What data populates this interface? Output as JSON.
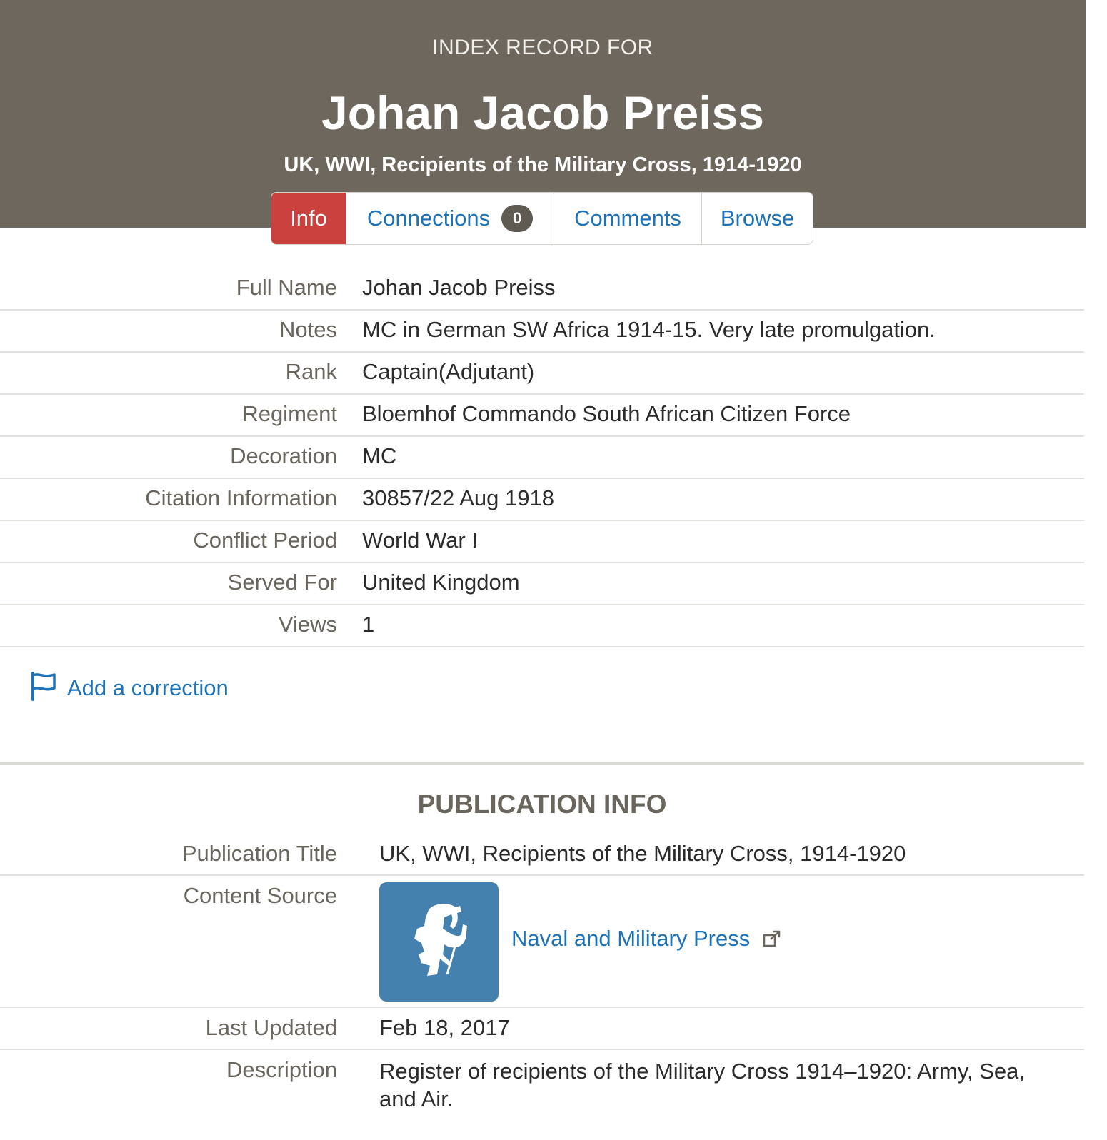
{
  "header": {
    "kicker": "INDEX RECORD FOR",
    "title": "Johan Jacob Preiss",
    "subtitle": "UK, WWI, Recipients of the Military Cross, 1914-1920",
    "background_color": "#6d675d"
  },
  "tabs": [
    {
      "label": "Info",
      "active": true
    },
    {
      "label": "Connections",
      "count": "0",
      "active": false
    },
    {
      "label": "Comments",
      "active": false
    },
    {
      "label": "Browse",
      "active": false
    }
  ],
  "record": {
    "rows": [
      {
        "label": "Full Name",
        "value": "Johan Jacob Preiss"
      },
      {
        "label": "Notes",
        "value": "MC in German SW Africa 1914-15. Very late promulgation."
      },
      {
        "label": "Rank",
        "value": "Captain(Adjutant)"
      },
      {
        "label": "Regiment",
        "value": "Bloemhof Commando South African Citizen Force"
      },
      {
        "label": "Decoration",
        "value": "MC"
      },
      {
        "label": "Citation Information",
        "value": "30857/22 Aug 1918"
      },
      {
        "label": "Conflict Period",
        "value": "World War I"
      },
      {
        "label": "Served For",
        "value": "United Kingdom"
      },
      {
        "label": "Views",
        "value": "1"
      }
    ]
  },
  "correction": {
    "label": "Add a correction",
    "icon": "flag-icon"
  },
  "publication": {
    "heading": "PUBLICATION INFO",
    "title_label": "Publication Title",
    "title_value": "UK, WWI, Recipients of the Military Cross, 1914-1920",
    "source_label": "Content Source",
    "source_name": "Naval and Military Press",
    "source_logo_icon": "saluting-soldier-icon",
    "updated_label": "Last Updated",
    "updated_value": "Feb 18, 2017",
    "description_label": "Description",
    "description_value": "Register of recipients of the Military Cross 1914–1920: Army, Sea, and Air."
  },
  "colors": {
    "accent_active_tab": "#c9403d",
    "link": "#1e73b8",
    "logo_background": "#4581ae"
  }
}
